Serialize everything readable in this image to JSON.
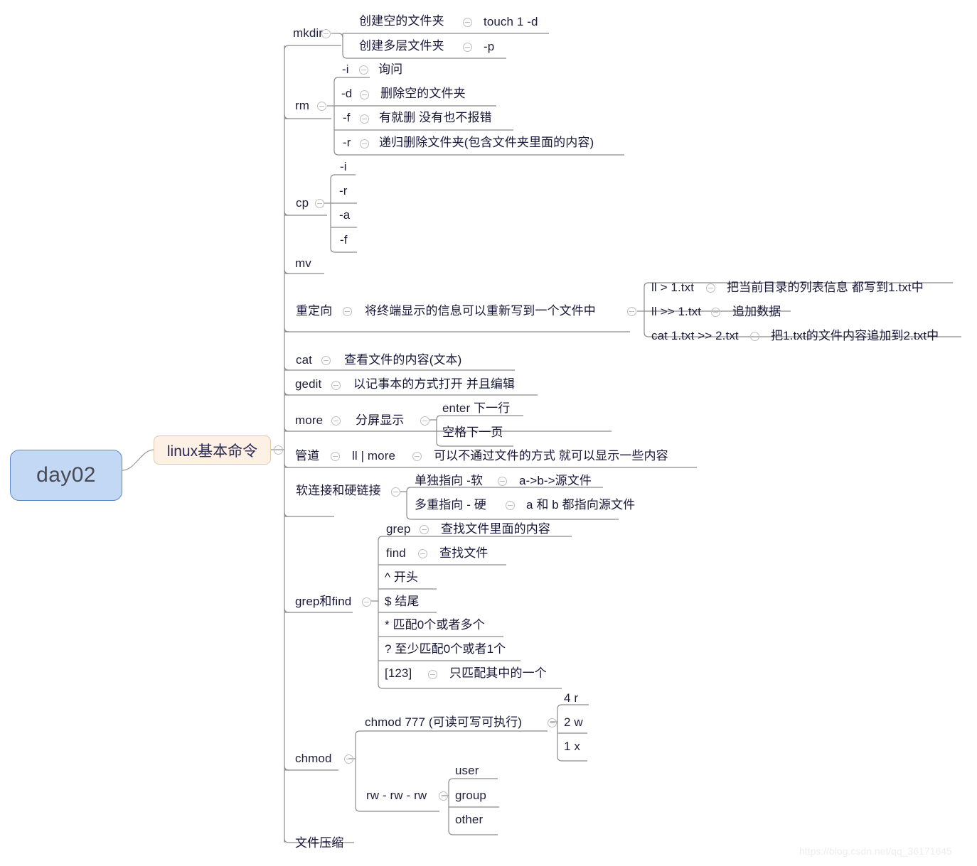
{
  "root": {
    "label": "day02"
  },
  "level1": {
    "label": "linux基本命令"
  },
  "watermark": "https://blog.csdn.net/qq_36171645",
  "icons": {
    "collapse": "circle-minus-icon"
  },
  "colors": {
    "root_fill": "#c3d8f5",
    "root_border": "#5f87c4",
    "root_text": "#4a4a52",
    "level1_fill": "#fdf0e5",
    "level1_border": "#e3c9ab",
    "node_text": "#1f1f3d",
    "line": "#8a8a8a",
    "collapse_icon": "#bdbdbd",
    "watermark": "#ededed"
  },
  "nodes": {
    "mkdir": "mkdir",
    "mkdir_c1": "创建空的文件夹",
    "mkdir_c1_c1": "touch 1 -d",
    "mkdir_c2": "创建多层文件夹",
    "mkdir_c2_c1": "-p",
    "rm": "rm",
    "rm_i": "-i",
    "rm_i_d": "询问",
    "rm_d": "-d",
    "rm_d_d": "删除空的文件夹",
    "rm_f": "-f",
    "rm_f_d": "有就删 没有也不报错",
    "rm_r": "-r",
    "rm_r_d": "递归删除文件夹(包含文件夹里面的内容)",
    "cp": "cp",
    "cp_i": "-i",
    "cp_r": "-r",
    "cp_a": "-a",
    "cp_f": "-f",
    "mv": "mv",
    "redirect": "重定向",
    "redirect_desc": "将终端显示的信息可以重新写到一个文件中",
    "rd_1": "ll > 1.txt",
    "rd_1_d": "把当前目录的列表信息 都写到1.txt中",
    "rd_2": "ll >> 1.txt",
    "rd_2_d": "追加数据",
    "rd_3": "cat 1.txt >> 2.txt",
    "rd_3_d": "把1.txt的文件内容追加到2.txt中",
    "cat": "cat",
    "cat_d": "查看文件的内容(文本)",
    "gedit": "gedit",
    "gedit_d": "以记事本的方式打开 并且编辑",
    "more": "more",
    "more_d": "分屏显示",
    "more_enter": "enter 下一行",
    "more_space": "空格下一页",
    "pipe": "管道",
    "pipe_cmd": "ll | more",
    "pipe_d": "可以不通过文件的方式 就可以显示一些内容",
    "link": "软连接和硬链接",
    "link_soft": "单独指向 -软",
    "link_soft_d": "a->b->源文件",
    "link_hard": "多重指向 - 硬",
    "link_hard_d": "a 和 b 都指向源文件",
    "grepfind": "grep和find",
    "grep": "grep",
    "grep_d": "查找文件里面的内容",
    "find": "find",
    "find_d": "查找文件",
    "re_caret": "^ 开头",
    "re_dollar": "$ 结尾",
    "re_star": "* 匹配0个或者多个",
    "re_question": "? 至少匹配0个或者1个",
    "re_class": "[123]",
    "re_class_d": "只匹配其中的一个",
    "chmod": "chmod",
    "chmod777": "chmod 777 (可读可写可执行)",
    "chmod_4r": "4 r",
    "chmod_2w": "2 w",
    "chmod_1x": "1 x",
    "rwrwrw": "rw - rw - rw",
    "user": "user",
    "group": "group",
    "other": "other",
    "compress": "文件压缩"
  }
}
